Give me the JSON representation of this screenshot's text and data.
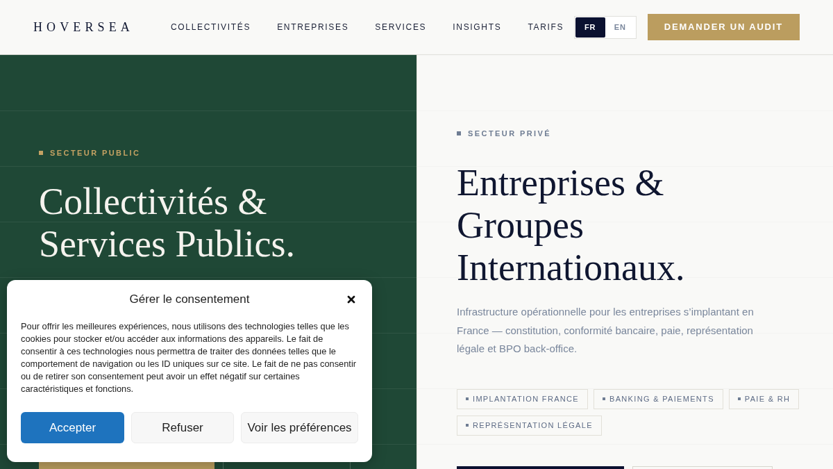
{
  "header": {
    "logo": "HOVERSEA",
    "nav": [
      "COLLECTIVITÉS",
      "ENTREPRISES",
      "SERVICES",
      "INSIGHTS",
      "TARIFS"
    ],
    "languages": [
      {
        "label": "FR",
        "selected": true
      },
      {
        "label": "EN",
        "selected": false
      }
    ],
    "cta": "DEMANDER UN AUDIT"
  },
  "public_sector": {
    "eyebrow": "SECTEUR PUBLIC",
    "title_lines": [
      "Collectivités &",
      "Services Publics."
    ],
    "actions": [
      {
        "kind": "primary"
      },
      {
        "kind": "outline"
      }
    ]
  },
  "private_sector": {
    "eyebrow": "SECTEUR PRIVÉ",
    "title_lines": [
      "Entreprises &",
      "Groupes",
      "Internationaux."
    ],
    "description": "Infrastructure opérationnelle pour les entreprises s’implantant en France — constitution, conformité bancaire, paie, représentation légale et BPO back-office.",
    "tags": [
      "IMPLANTATION FRANCE",
      "BANKING & PAIEMENTS",
      "PAIE & RH",
      "REPRÉSENTATION LÉGALE"
    ],
    "actions": [
      {
        "kind": "primary"
      },
      {
        "kind": "outline"
      }
    ]
  },
  "consent_dialog": {
    "title": "Gérer le consentement",
    "body": "Pour offrir les meilleures expériences, nous utilisons des technologies telles que les cookies pour stocker et/ou accéder aux informations des appareils. Le fait de consentir à ces technologies nous permettra de traiter des données telles que le comportement de navigation ou les ID uniques sur ce site. Le fait de ne pas consentir ou de retirer son consentement peut avoir un effet négatif sur certaines caractéristiques et fonctions.",
    "buttons": [
      {
        "label": "Accepter",
        "kind": "primary"
      },
      {
        "label": "Refuser",
        "kind": "secondary"
      },
      {
        "label": "Voir les préférences",
        "kind": "secondary"
      }
    ]
  }
}
